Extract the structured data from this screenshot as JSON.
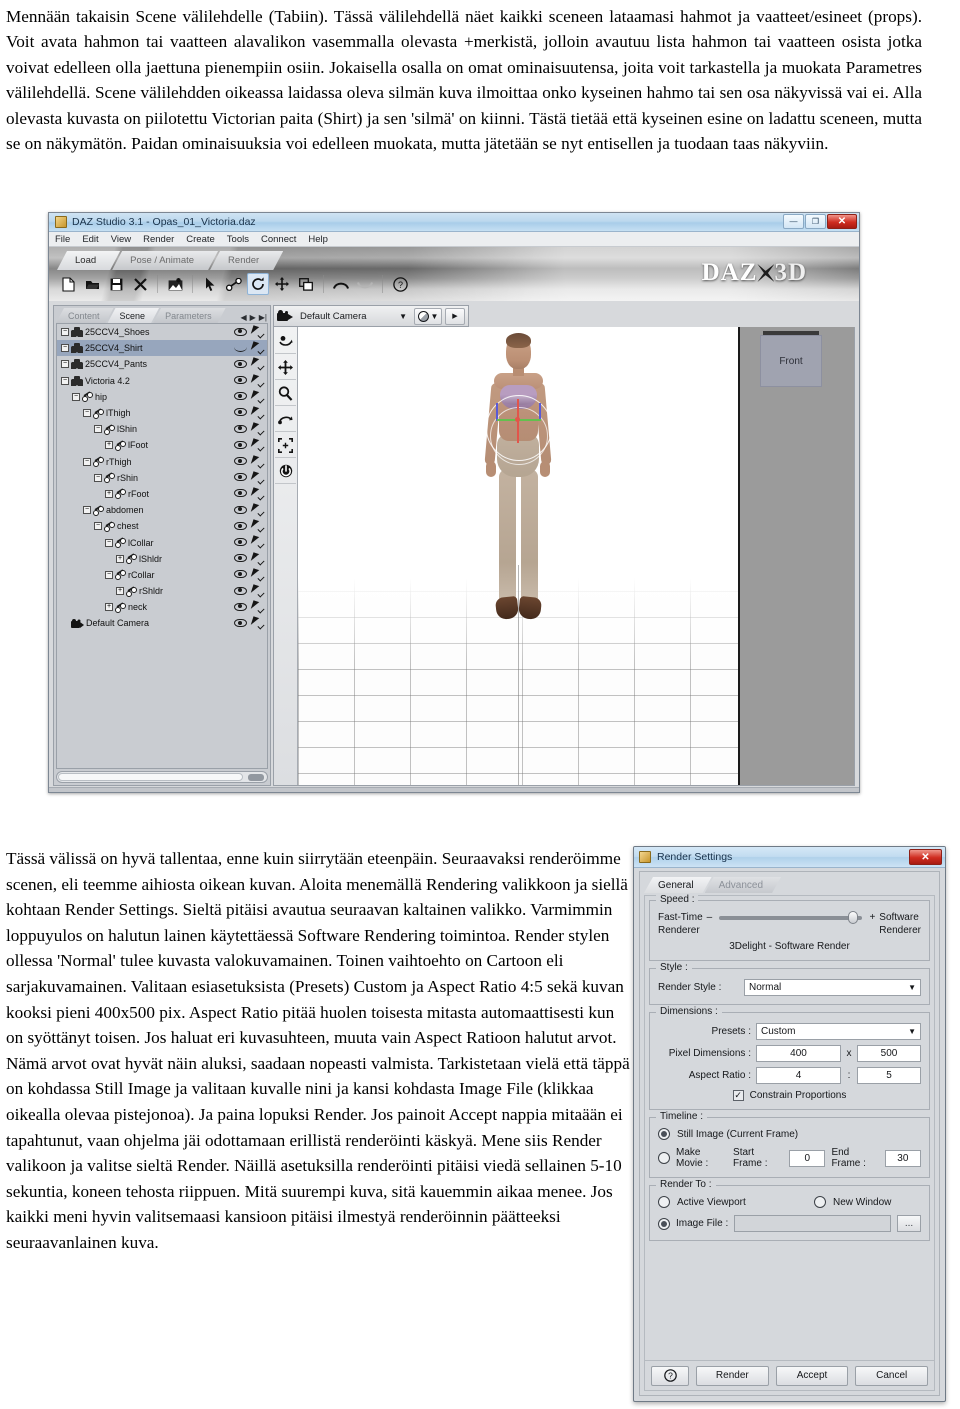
{
  "document": {
    "top_paragraph": "Mennään takaisin Scene välilehdelle (Tabiin). Tässä välilehdellä näet kaikki sceneen lataamasi hahmot ja vaatteet/esineet (props). Voit avata hahmon tai vaatteen alavalikon vasemmalla olevasta +merkistä, jolloin avautuu lista hahmon tai vaatteen osista jotka voivat edelleen olla jaettuna pienempiin osiin. Jokaisella osalla on omat ominaisuutensa, joita voit tarkastella ja muokata Parametres välilehdellä. Scene välilehdden oikeassa laidassa oleva silmän kuva ilmoittaa onko kyseinen hahmo tai sen osa näkyvissä vai ei. Alla olevasta kuvasta on piilotettu Victorian paita (Shirt) ja sen 'silmä' on kiinni. Tästä tietää että kyseinen esine on ladattu sceneen, mutta se on näkymätön. Paidan ominaisuuksia voi edelleen muokata, mutta jätetään se nyt entisellen ja tuodaan taas näkyviin.",
    "bottom_paragraph": "Tässä välissä on hyvä tallentaa, enne kuin siirrytään eteenpäin. Seuraavaksi renderöimme scenen, eli teemme aihiosta oikean kuvan. Aloita menemällä Rendering valikkoon ja siellä kohtaan Render Settings. Sieltä pitäisi avautua seuraavan kaltainen valikko. Varmimmin loppuyulos on halutun lainen käytettäessä Software Rendering toimintoa. Render stylen ollessa 'Normal' tulee kuvasta valokuvamainen. Toinen vaihtoehto on Cartoon eli sarjakuvamainen. Valitaan esiasetuksista (Presets) Custom ja Aspect Ratio 4:5 sekä kuvan kooksi pieni 400x500 pix. Aspect Ratio pitää huolen toisesta mitasta automaattisesti kun on syöttänyt toisen. Jos haluat eri kuvasuhteen, muuta vain Aspect Ratioon halutut arvot. Nämä arvot ovat hyvät näin aluksi, saadaan nopeasti valmista. Tarkistetaan vielä että täppä on kohdassa Still Image ja valitaan kuvalle nini ja kansi kohdasta Image File (klikkaa oikealla olevaa pistejonoa). Ja paina lopuksi Render. Jos painoit Accept nappia mitaään ei tapahtunut, vaan ohjelma jäi odottamaan erillistä renderöinti käskyä. Mene siis Render valikoon ja valitse sieltä Render. Näillä asetuksilla renderöinti pitäisi viedä sellainen 5-10 sekuntia, koneen tehosta riippuen. Mitä suurempi kuva, sitä kauemmin aikaa menee. Jos kaikki meni hyvin valitsemaasi kansioon pitäisi ilmestyä renderöinnin päätteeksi seuraavanlainen kuva."
  },
  "daz_window": {
    "title": "DAZ Studio 3.1  -  Opas_01_Victoria.daz",
    "window_buttons": {
      "minimize": "—",
      "maximize": "❐",
      "close": "✕"
    },
    "menu": [
      "File",
      "Edit",
      "View",
      "Render",
      "Create",
      "Tools",
      "Connect",
      "Help"
    ],
    "activity_tabs": [
      {
        "label": "Load",
        "active": true
      },
      {
        "label": "Pose / Animate",
        "active": false
      },
      {
        "label": "Render",
        "active": false
      }
    ],
    "logo": {
      "daz": "DAZ",
      "three_d": "3D"
    },
    "toolbar_icons": [
      "new-file-icon",
      "open-folder-icon",
      "save-icon",
      "delete-x-icon",
      "render-image-icon",
      "select-arrow-icon",
      "bone-tool-icon",
      "rotate-tool-icon",
      "translate-tool-icon",
      "scale-tool-icon",
      "undo-icon",
      "redo-icon",
      "help-icon"
    ],
    "left_panel": {
      "tabs": [
        {
          "label": "Content",
          "active": false
        },
        {
          "label": "Scene",
          "active": true
        },
        {
          "label": "Parameters",
          "active": false
        }
      ],
      "tab_nav": [
        "◀",
        "▶",
        "▶|"
      ],
      "tree": [
        {
          "label": "25CCV4_Shoes",
          "depth": 0,
          "expander": "−",
          "icon": "group-icon",
          "eye": "open",
          "selected": false
        },
        {
          "label": "25CCV4_Shirt",
          "depth": 0,
          "expander": "−",
          "icon": "group-icon",
          "eye": "closed",
          "selected": true
        },
        {
          "label": "25CCV4_Pants",
          "depth": 0,
          "expander": "−",
          "icon": "group-icon",
          "eye": "open",
          "selected": false
        },
        {
          "label": "Victoria 4.2",
          "depth": 0,
          "expander": "−",
          "icon": "group-icon",
          "eye": "open",
          "selected": false
        },
        {
          "label": "hip",
          "depth": 1,
          "expander": "−",
          "icon": "bone-icon",
          "eye": "open",
          "selected": false
        },
        {
          "label": "lThigh",
          "depth": 2,
          "expander": "−",
          "icon": "bone-icon",
          "eye": "open",
          "selected": false
        },
        {
          "label": "lShin",
          "depth": 3,
          "expander": "−",
          "icon": "bone-icon",
          "eye": "open",
          "selected": false
        },
        {
          "label": "lFoot",
          "depth": 4,
          "expander": "+",
          "icon": "bone-icon",
          "eye": "open",
          "selected": false
        },
        {
          "label": "rThigh",
          "depth": 2,
          "expander": "−",
          "icon": "bone-icon",
          "eye": "open",
          "selected": false
        },
        {
          "label": "rShin",
          "depth": 3,
          "expander": "−",
          "icon": "bone-icon",
          "eye": "open",
          "selected": false
        },
        {
          "label": "rFoot",
          "depth": 4,
          "expander": "+",
          "icon": "bone-icon",
          "eye": "open",
          "selected": false
        },
        {
          "label": "abdomen",
          "depth": 2,
          "expander": "−",
          "icon": "bone-icon",
          "eye": "open",
          "selected": false
        },
        {
          "label": "chest",
          "depth": 3,
          "expander": "−",
          "icon": "bone-icon",
          "eye": "open",
          "selected": false
        },
        {
          "label": "lCollar",
          "depth": 4,
          "expander": "−",
          "icon": "bone-icon",
          "eye": "open",
          "selected": false
        },
        {
          "label": "lShldr",
          "depth": 5,
          "expander": "+",
          "icon": "bone-icon",
          "eye": "open",
          "selected": false
        },
        {
          "label": "rCollar",
          "depth": 4,
          "expander": "−",
          "icon": "bone-icon",
          "eye": "open",
          "selected": false
        },
        {
          "label": "rShldr",
          "depth": 5,
          "expander": "+",
          "icon": "bone-icon",
          "eye": "open",
          "selected": false
        },
        {
          "label": "neck",
          "depth": 4,
          "expander": "+",
          "icon": "bone-icon",
          "eye": "open",
          "selected": false
        },
        {
          "label": "Default Camera",
          "depth": 0,
          "expander": "",
          "icon": "camera-icon",
          "eye": "open",
          "selected": false
        }
      ]
    },
    "viewport": {
      "camera": "Default Camera",
      "view_cube_label": "Front",
      "tools": [
        "orbit-icon",
        "pan-icon",
        "zoom-icon",
        "rotate-view-icon",
        "frame-icon",
        "reset-view-icon"
      ]
    }
  },
  "render_settings": {
    "title": "Render Settings",
    "close_label": "✕",
    "tabs": [
      {
        "label": "General",
        "active": true
      },
      {
        "label": "Advanced",
        "active": false
      }
    ],
    "speed": {
      "group_label": "Speed :",
      "left_label_line1": "Fast-Time",
      "left_label_line2": "Renderer",
      "right_label_line1": "Software",
      "right_label_line2": "Renderer",
      "minus": "–",
      "plus": "+",
      "renderer_name": "3Delight - Software Render"
    },
    "style": {
      "group_label": "Style :",
      "render_style_label": "Render Style :",
      "render_style_value": "Normal"
    },
    "dimensions": {
      "group_label": "Dimensions :",
      "presets_label": "Presets :",
      "presets_value": "Custom",
      "pixel_dimensions_label": "Pixel Dimensions :",
      "pixel_width": "400",
      "pixel_separator": "x",
      "pixel_height": "500",
      "aspect_ratio_label": "Aspect Ratio :",
      "aspect_w": "4",
      "aspect_separator": ":",
      "aspect_h": "5",
      "constrain_label": "Constrain Proportions",
      "constrain_checked": "✓"
    },
    "timeline": {
      "group_label": "Timeline :",
      "still_image_label": "Still Image (Current Frame)",
      "make_movie_label": "Make Movie :",
      "start_frame_label": "Start Frame :",
      "start_frame_value": "0",
      "end_frame_label": "End Frame :",
      "end_frame_value": "30"
    },
    "render_to": {
      "group_label": "Render To :",
      "active_viewport_label": "Active Viewport",
      "new_window_label": "New Window",
      "image_file_label": "Image File :",
      "image_file_value": "",
      "browse_label": "..."
    },
    "footer": {
      "help_label": "?",
      "render_label": "Render",
      "accept_label": "Accept",
      "cancel_label": "Cancel"
    }
  }
}
